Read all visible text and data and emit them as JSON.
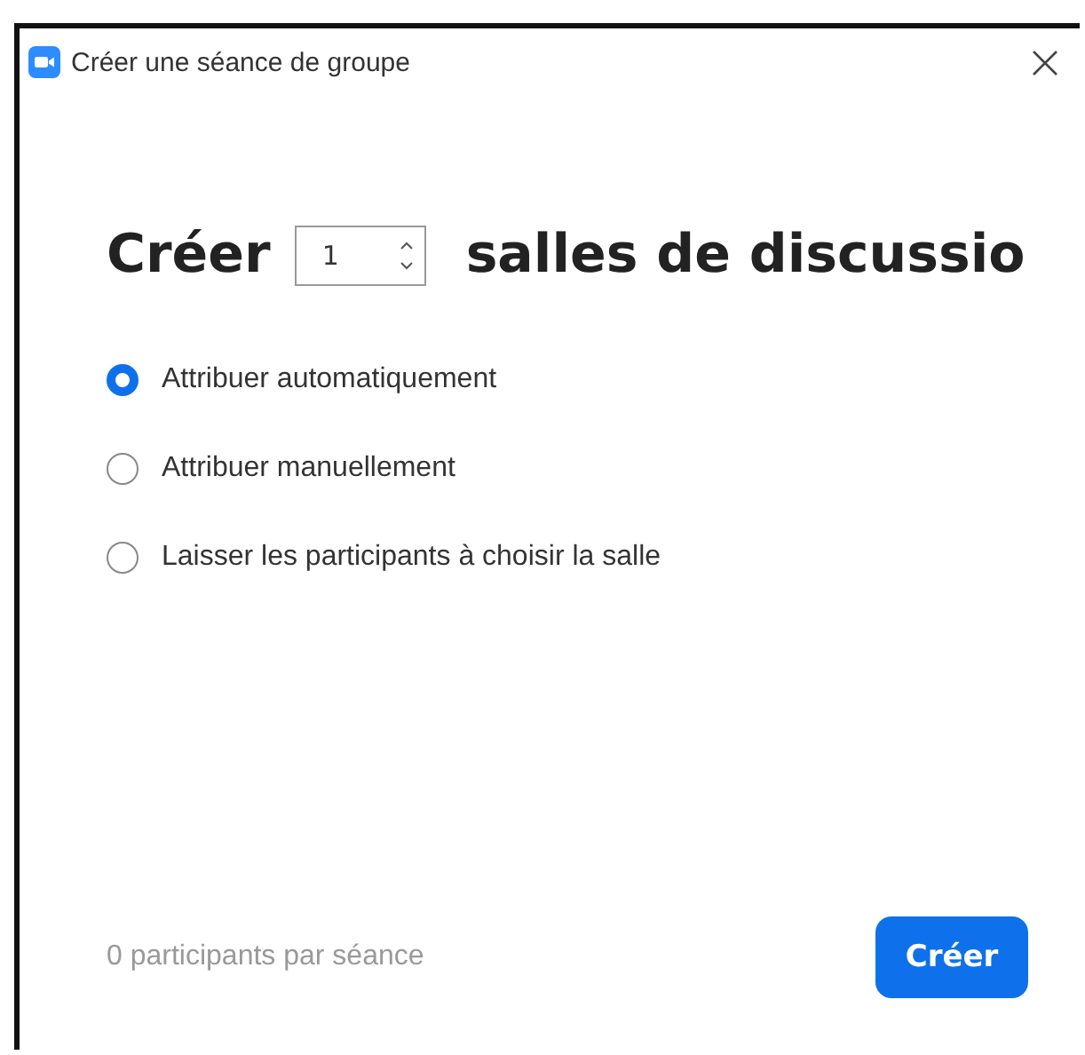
{
  "window": {
    "title": "Créer une séance de groupe"
  },
  "heading": {
    "before": "Créer",
    "after": "salles de discussio"
  },
  "room_count": {
    "value": "1"
  },
  "options": [
    {
      "label": "Attribuer automatiquement",
      "selected": true
    },
    {
      "label": "Attribuer manuellement",
      "selected": false
    },
    {
      "label": "Laisser les participants à choisir la salle",
      "selected": false
    }
  ],
  "footer": {
    "note": "0 participants par séance",
    "button": "Créer"
  }
}
